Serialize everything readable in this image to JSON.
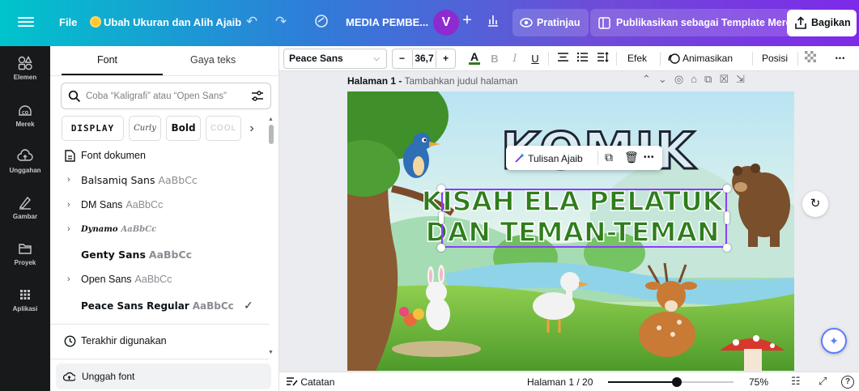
{
  "topbar": {
    "file_label": "File",
    "resize_label": "Ubah Ukuran dan Alih Ajaib",
    "doc_title": "MEDIA PEMBE...",
    "avatar_initial": "V",
    "add_label": "+",
    "preview_label": "Pratinjau",
    "publish_label": "Publikasikan sebagai Template Merek",
    "share_label": "Bagikan"
  },
  "rail": [
    {
      "label": "Elemen",
      "icon": "elements-icon"
    },
    {
      "label": "Merek",
      "icon": "brand-icon"
    },
    {
      "label": "Unggahan",
      "icon": "uploads-icon"
    },
    {
      "label": "Gambar",
      "icon": "draw-icon"
    },
    {
      "label": "Proyek",
      "icon": "projects-icon"
    },
    {
      "label": "Aplikasi",
      "icon": "apps-icon"
    }
  ],
  "panel": {
    "tabs": [
      "Font",
      "Gaya teks"
    ],
    "active_tab": "Font",
    "search_placeholder": "Coba “Kaligrafi” atau “Open Sans”",
    "chips": [
      "DISPLAY",
      "Curly",
      "Bold",
      "COOL"
    ],
    "doc_fonts_heading": "Font dokumen",
    "fonts": [
      {
        "name": "Balsamiq Sans",
        "sample": "AaBbCc",
        "expandable": true,
        "selected": false
      },
      {
        "name": "DM Sans",
        "sample": "AaBbCc",
        "expandable": true,
        "selected": false
      },
      {
        "name": "Dynamo",
        "sample": "AaBbCc",
        "expandable": true,
        "selected": false
      },
      {
        "name": "Genty Sans",
        "sample": "AaBbCc",
        "expandable": false,
        "selected": false
      },
      {
        "name": "Open Sans",
        "sample": "AaBbCc",
        "expandable": true,
        "selected": false
      },
      {
        "name": "Peace Sans Regular",
        "sample": "AaBbCc",
        "expandable": false,
        "selected": true
      }
    ],
    "recent_label": "Terakhir digunakan",
    "upload_font_label": "Unggah font"
  },
  "toolbar": {
    "font_name": "Peace Sans",
    "font_size": "36,7",
    "effects_label": "Efek",
    "animate_label": "Animasikan",
    "position_label": "Posisi",
    "more_label": "•••"
  },
  "canvas": {
    "page_label": "Halaman 1 -",
    "page_placeholder": "Tambahkan judul halaman",
    "title_art": "KOMIK",
    "headline_line1": "KISAH ELA PELATUK",
    "headline_line2": "DAN TEMAN-TEMAN",
    "context_menu": {
      "magic_write": "Tulisan Ajaib"
    }
  },
  "status": {
    "notes_label": "Catatan",
    "page_indicator": "Halaman 1 / 20",
    "zoom_percent": 75,
    "zoom_label": "75%",
    "zoom_slider_fraction": 0.55,
    "help_label": "?"
  },
  "colors": {
    "brand_gradient_start": "#00c4cc",
    "brand_gradient_end": "#7d2ae8",
    "selection": "#8b3dff",
    "headline_fill": "#2f7d1c",
    "headline_stroke": "#ffffff"
  }
}
